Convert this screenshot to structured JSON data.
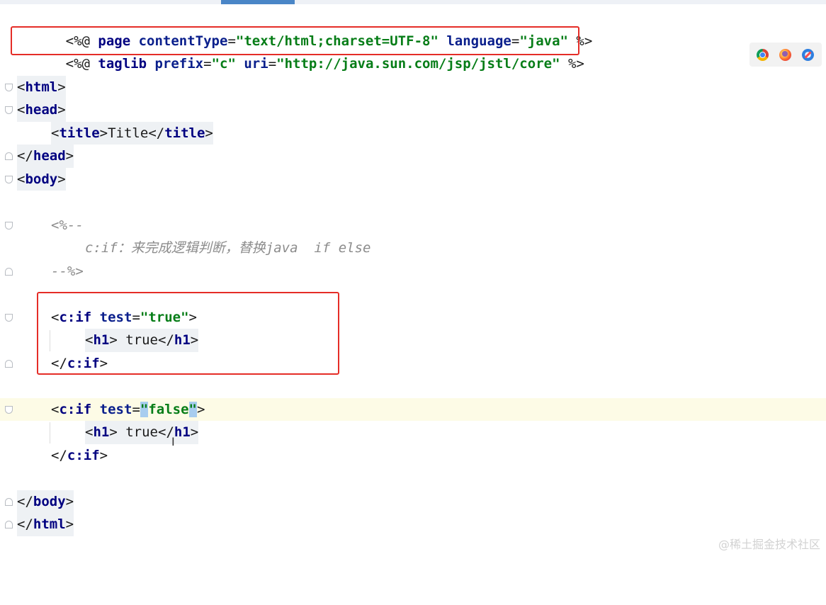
{
  "editor": {
    "lines": {
      "directive": {
        "open": "<%@ ",
        "page": "page ",
        "attr1": "contentType",
        "eq1": "=",
        "val1": "\"text/html;charset=UTF-8\"",
        "sp": " ",
        "attr2": "language",
        "eq2": "=",
        "val2": "\"java\"",
        "close": " %>"
      },
      "taglib": {
        "open": "<%@ ",
        "name": "taglib ",
        "attr1": "prefix",
        "eq1": "=",
        "val1": "\"c\"",
        "sp": " ",
        "attr2": "uri",
        "eq2": "=",
        "val2": "\"http://java.sun.com/jsp/jstl/core\"",
        "close": " %>"
      },
      "html_open": {
        "lt": "<",
        "tag": "html",
        "gt": ">"
      },
      "head_open": {
        "lt": "<",
        "tag": "head",
        "gt": ">"
      },
      "title": {
        "lt1": "<",
        "tag1": "title",
        "gt1": ">",
        "text": "Title",
        "lt2": "</",
        "tag2": "title",
        "gt2": ">"
      },
      "head_close": {
        "lt": "</",
        "tag": "head",
        "gt": ">"
      },
      "body_open": {
        "lt": "<",
        "tag": "body",
        "gt": ">"
      },
      "comment_open": "<%--",
      "comment_text": "c:if：来完成逻辑判断，替换java  if else",
      "comment_close": "--%>",
      "if_true_open": {
        "lt": "<",
        "tag": "c:if",
        "sp": " ",
        "attr": "test",
        "eq": "=",
        "val": "\"true\"",
        "gt": ">"
      },
      "h1_true": {
        "lt1": "<",
        "tag1": "h1",
        "gt1": ">",
        "text": " true",
        "lt2": "</",
        "tag2": "h1",
        "gt2": ">"
      },
      "if_true_close": {
        "lt": "</",
        "tag": "c:if",
        "gt": ">"
      },
      "if_false_open": {
        "lt": "<",
        "tag": "c:if",
        "sp": " ",
        "attr": "test",
        "eq": "=",
        "q1": "\"",
        "val": "false",
        "q2": "\"",
        "gt": ">"
      },
      "h1_false": {
        "lt1": "<",
        "tag1": "h1",
        "gt1": ">",
        "text": " true",
        "lt2": "</",
        "tag2": "h1",
        "gt2": ">"
      },
      "if_false_close": {
        "lt": "</",
        "tag": "c:if",
        "gt": ">"
      },
      "body_close": {
        "lt": "</",
        "tag": "body",
        "gt": ">"
      },
      "html_close": {
        "lt": "</",
        "tag": "html",
        "gt": ">"
      }
    }
  },
  "text_cursor_glyph": "I",
  "browser_icons": [
    "chrome-icon",
    "firefox-icon",
    "safari-icon"
  ],
  "watermark": "@稀土掘金技术社区",
  "colors": {
    "highlight_box": "#e52d27",
    "tag": "#000080",
    "string": "#067d17",
    "comment": "#8c8c8c",
    "current_line": "#fdfbe6"
  }
}
